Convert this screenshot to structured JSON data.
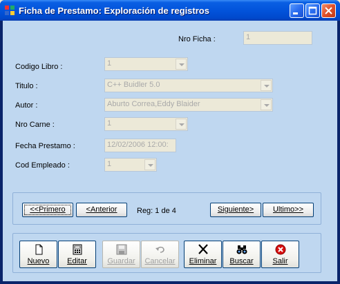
{
  "window": {
    "title": "Ficha de Prestamo: Exploración de registros"
  },
  "form": {
    "nro_ficha": {
      "label": "Nro Ficha :",
      "value": "1"
    },
    "codigo_libro": {
      "label": "Codigo Libro :",
      "value": "1"
    },
    "titulo": {
      "label": "Titulo :",
      "value": "C++ Buidler 5.0"
    },
    "autor": {
      "label": "Autor :",
      "value": "Aburto Correa,Eddy Blaider"
    },
    "nro_carne": {
      "label": "Nro Carne :",
      "value": "1"
    },
    "fecha_prestamo": {
      "label": "Fecha Prestamo :",
      "value": "12/02/2006 12:00:"
    },
    "cod_empleado": {
      "label": "Cod Empleado :",
      "value": "1"
    }
  },
  "navigation": {
    "first_label": "<<Primero",
    "prev_label": "<Anterior",
    "record_text": "Reg:  1 de  4",
    "next_label": "Siguiente>",
    "last_label": "Ultimo>>"
  },
  "toolbar": {
    "nuevo": "Nuevo",
    "editar": "Editar",
    "guardar": "Guardar",
    "cancelar": "Cancelar",
    "eliminar": "Eliminar",
    "buscar": "Buscar",
    "salir": "Salir"
  },
  "colors": {
    "title_bar": "#0254db",
    "client_background": "#bfd7f0",
    "close_button": "#e0502a"
  }
}
